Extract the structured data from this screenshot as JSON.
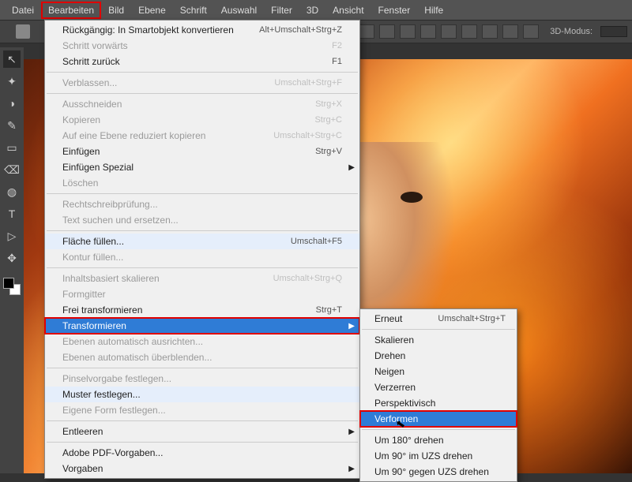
{
  "menubar": [
    "Datei",
    "Bearbeiten",
    "Bild",
    "Ebene",
    "Schrift",
    "Auswahl",
    "Filter",
    "3D",
    "Ansicht",
    "Fenster",
    "Hilfe"
  ],
  "menubar_highlight_index": 1,
  "toolbar": {
    "label_3d": "3D-Modus:"
  },
  "edit_menu": [
    {
      "t": "item",
      "label": "Rückgängig: In Smartobjekt konvertieren",
      "sc": "Alt+Umschalt+Strg+Z"
    },
    {
      "t": "item",
      "label": "Schritt vorwärts",
      "sc": "F2",
      "disabled": true
    },
    {
      "t": "item",
      "label": "Schritt zurück",
      "sc": "F1"
    },
    {
      "t": "sep"
    },
    {
      "t": "item",
      "label": "Verblassen...",
      "sc": "Umschalt+Strg+F",
      "disabled": true
    },
    {
      "t": "sep"
    },
    {
      "t": "item",
      "label": "Ausschneiden",
      "sc": "Strg+X",
      "disabled": true
    },
    {
      "t": "item",
      "label": "Kopieren",
      "sc": "Strg+C",
      "disabled": true
    },
    {
      "t": "item",
      "label": "Auf eine Ebene reduziert kopieren",
      "sc": "Umschalt+Strg+C",
      "disabled": true
    },
    {
      "t": "item",
      "label": "Einfügen",
      "sc": "Strg+V"
    },
    {
      "t": "item",
      "label": "Einfügen Spezial",
      "sub": true
    },
    {
      "t": "item",
      "label": "Löschen",
      "disabled": true
    },
    {
      "t": "sep"
    },
    {
      "t": "item",
      "label": "Rechtschreibprüfung...",
      "disabled": true
    },
    {
      "t": "item",
      "label": "Text suchen und ersetzen...",
      "disabled": true
    },
    {
      "t": "sep"
    },
    {
      "t": "item",
      "label": "Fläche füllen...",
      "sc": "Umschalt+F5",
      "hover": true
    },
    {
      "t": "item",
      "label": "Kontur füllen...",
      "disabled": true
    },
    {
      "t": "sep"
    },
    {
      "t": "item",
      "label": "Inhaltsbasiert skalieren",
      "sc": "Umschalt+Strg+Q",
      "disabled": true
    },
    {
      "t": "item",
      "label": "Formgitter",
      "disabled": true
    },
    {
      "t": "item",
      "label": "Frei transformieren",
      "sc": "Strg+T"
    },
    {
      "t": "item",
      "label": "Transformieren",
      "sub": true,
      "selected": true,
      "redbox": true
    },
    {
      "t": "item",
      "label": "Ebenen automatisch ausrichten...",
      "disabled": true
    },
    {
      "t": "item",
      "label": "Ebenen automatisch überblenden...",
      "disabled": true
    },
    {
      "t": "sep"
    },
    {
      "t": "item",
      "label": "Pinselvorgabe festlegen...",
      "disabled": true
    },
    {
      "t": "item",
      "label": "Muster festlegen...",
      "hover": true
    },
    {
      "t": "item",
      "label": "Eigene Form festlegen...",
      "disabled": true
    },
    {
      "t": "sep"
    },
    {
      "t": "item",
      "label": "Entleeren",
      "sub": true
    },
    {
      "t": "sep"
    },
    {
      "t": "item",
      "label": "Adobe PDF-Vorgaben..."
    },
    {
      "t": "item",
      "label": "Vorgaben",
      "sub": true
    }
  ],
  "transform_submenu": [
    {
      "t": "item",
      "label": "Erneut",
      "sc": "Umschalt+Strg+T"
    },
    {
      "t": "sep"
    },
    {
      "t": "item",
      "label": "Skalieren"
    },
    {
      "t": "item",
      "label": "Drehen"
    },
    {
      "t": "item",
      "label": "Neigen"
    },
    {
      "t": "item",
      "label": "Verzerren"
    },
    {
      "t": "item",
      "label": "Perspektivisch"
    },
    {
      "t": "item",
      "label": "Verformen",
      "selected": true,
      "redbox": true
    },
    {
      "t": "sep"
    },
    {
      "t": "item",
      "label": "Um 180° drehen"
    },
    {
      "t": "item",
      "label": "Um 90° im UZS drehen"
    },
    {
      "t": "item",
      "label": "Um 90° gegen UZS drehen"
    }
  ],
  "tools": [
    "↖",
    "✦",
    "◑",
    "✎",
    "▭",
    "⌫",
    "◍",
    "T",
    "▷",
    "✥"
  ]
}
